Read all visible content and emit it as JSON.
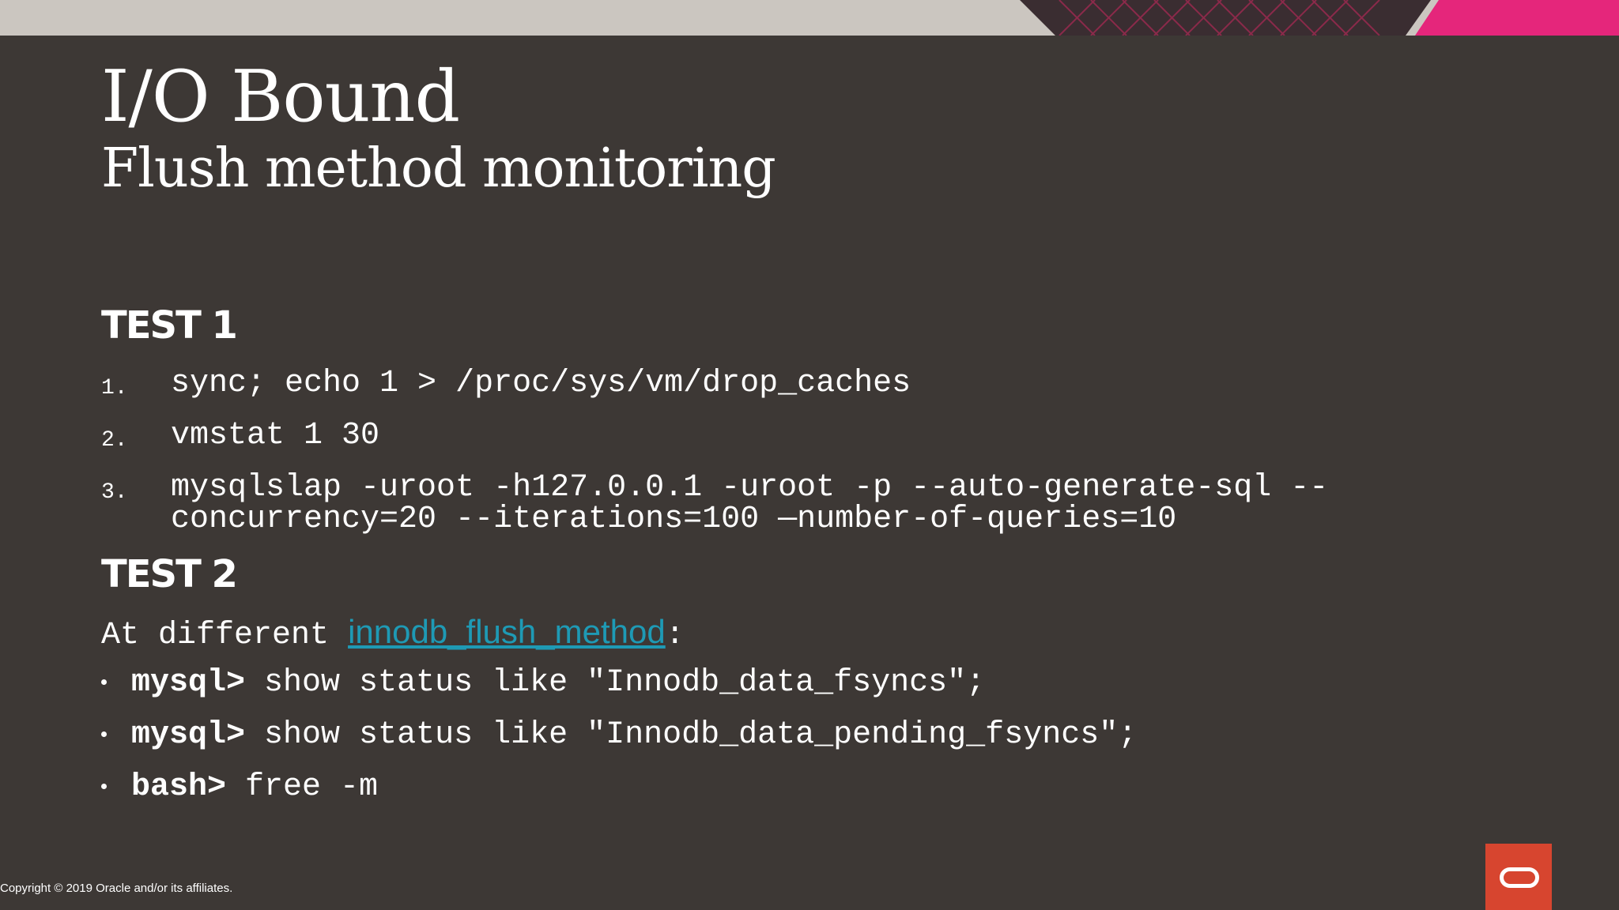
{
  "slide": {
    "title": "I/O Bound",
    "subtitle": "Flush method monitoring"
  },
  "test1": {
    "heading": "TEST 1",
    "steps": [
      {
        "num": "1.",
        "lines": [
          "sync; echo 1 > /proc/sys/vm/drop_caches"
        ]
      },
      {
        "num": "2.",
        "lines": [
          "vmstat 1 30"
        ]
      },
      {
        "num": "3.",
        "lines": [
          "mysqlslap -uroot -h127.0.0.1 -uroot -p --auto-generate-sql --",
          "concurrency=20 --iterations=100 —number-of-queries=10"
        ]
      }
    ]
  },
  "test2": {
    "heading": "TEST 2",
    "intro_prefix": "At different ",
    "intro_link": "innodb_flush_method",
    "intro_suffix": ":",
    "bullets": [
      {
        "prompt": "mysql>",
        "command": " show status like \"Innodb_data_fsyncs\";"
      },
      {
        "prompt": "mysql>",
        "command": " show status like \"Innodb_data_pending_fsyncs\";"
      },
      {
        "prompt": "bash>",
        "command": " free -m"
      }
    ]
  },
  "footer": {
    "copyright": "Copyright © 2019 Oracle and/or its affiliates."
  },
  "colors": {
    "background": "#3d3835",
    "top_band": "#cbc6c0",
    "accent_pink": "#e5267b",
    "link": "#1e9ab5",
    "logo_red": "#d7452f"
  },
  "icons": {
    "logo": "oracle-logo-icon"
  }
}
